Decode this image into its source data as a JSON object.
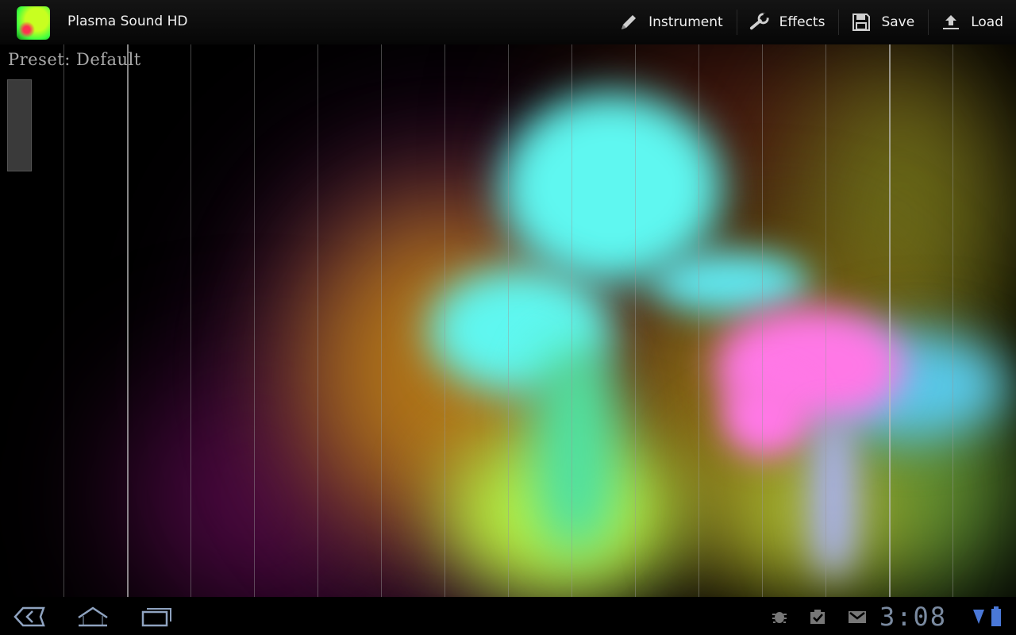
{
  "app": {
    "title": "Plasma Sound HD",
    "icon": "app-icon"
  },
  "actions": [
    {
      "label": "Instrument",
      "icon": "pencil-icon"
    },
    {
      "label": "Effects",
      "icon": "wrench-icon"
    },
    {
      "label": "Save",
      "icon": "floppy-disk-icon"
    },
    {
      "label": "Load",
      "icon": "upload-icon"
    }
  ],
  "stage": {
    "preset_label": "Preset: Default",
    "colors": {
      "cyan": "#5ff7f0",
      "pink": "#ff78e6",
      "yellow_green": "#b8f040",
      "amber": "#b87818",
      "olive": "#707020",
      "purple": "#3a0838"
    }
  },
  "system_bar": {
    "clock": "3:08",
    "nav": [
      "back-icon",
      "home-icon",
      "recent-apps-icon"
    ],
    "status_icons": [
      "debug-icon",
      "download-done-icon",
      "gmail-icon",
      "wifi-icon",
      "battery-icon"
    ]
  }
}
